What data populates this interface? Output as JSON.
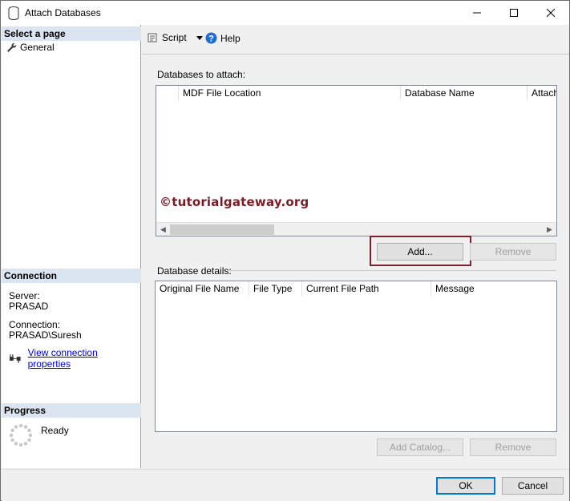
{
  "window": {
    "title": "Attach Databases"
  },
  "left_panel": {
    "select_page_header": "Select a page",
    "pages": [
      {
        "label": "General"
      }
    ],
    "connection_header": "Connection",
    "server_label": "Server:",
    "server_value": "PRASAD",
    "connection_label": "Connection:",
    "connection_value": "PRASAD\\Suresh",
    "view_connection_link": "View connection properties",
    "progress_header": "Progress",
    "progress_status": "Ready"
  },
  "toolbar": {
    "script_label": "Script",
    "help_label": "Help"
  },
  "databases_to_attach": {
    "label": "Databases to attach:",
    "columns": [
      "MDF File Location",
      "Database Name",
      "Attach"
    ],
    "rows": [],
    "watermark": "©tutorialgateway.org",
    "add_button": "Add...",
    "remove_button": "Remove"
  },
  "database_details": {
    "label": "Database details:",
    "columns": [
      "Original File Name",
      "File Type",
      "Current File Path",
      "Message"
    ],
    "rows": [],
    "add_catalog_button": "Add Catalog...",
    "remove_button": "Remove"
  },
  "footer": {
    "ok_button": "OK",
    "cancel_button": "Cancel"
  },
  "colors": {
    "section_header_bg": "#dbe4f1",
    "link": "#0000ee",
    "highlight_box": "#7f1f2f",
    "watermark": "#7b1c24",
    "default_button_border": "#0078d7",
    "help_icon": "#1e6fd0"
  },
  "icons": {
    "title": "database-icon",
    "general_page": "wrench-icon",
    "connection_link": "plug-icon",
    "progress": "spinner-icon",
    "script": "script-icon",
    "script_dropdown": "chevron-down-icon",
    "help": "help-icon"
  }
}
